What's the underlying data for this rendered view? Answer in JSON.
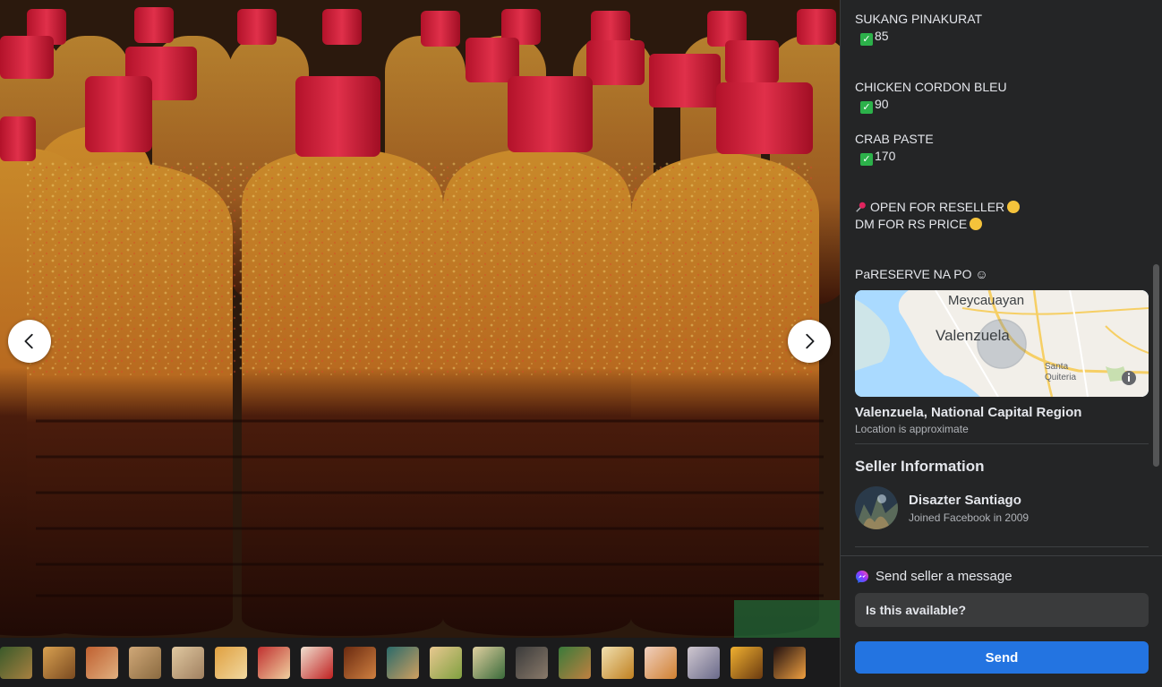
{
  "listing": {
    "description": [
      {
        "name": "SUKANG PINAKURAT",
        "price": "85"
      },
      {
        "name": "CHICKEN CORDON BLEU",
        "price": "90"
      },
      {
        "name": "CRAB PASTE",
        "price": "170"
      }
    ],
    "reseller_line": "OPEN FOR RESELLER",
    "dm_line": "DM FOR RS PRICE",
    "reserve_line": "PaRESERVE NA PO ☺"
  },
  "map": {
    "label_north": "Meycauayan",
    "label_center": "Valenzuela",
    "label_east_1": "Santa",
    "label_east_2": "Quiteria",
    "water_color": "#aadaff",
    "land_color": "#f2efe9",
    "road_color": "#f6cf65"
  },
  "location": {
    "title": "Valenzuela, National Capital Region",
    "subtitle": "Location is approximate"
  },
  "seller": {
    "section_title": "Seller Information",
    "name": "Disazter Santiago",
    "joined": "Joined Facebook in 2009"
  },
  "composer": {
    "label": "Send seller a message",
    "input_value": "Is this available?",
    "send_label": "Send"
  },
  "icons": {
    "prev": "chevron-left-icon",
    "next": "chevron-right-icon",
    "check": "check-mark-icon",
    "pin": "pushpin-icon",
    "smile": "smiling-face-icon",
    "messenger": "messenger-icon",
    "info": "info-icon"
  },
  "colors": {
    "panel_bg": "#242526",
    "accent": "#2374e1",
    "check_green": "#2cb14a"
  }
}
